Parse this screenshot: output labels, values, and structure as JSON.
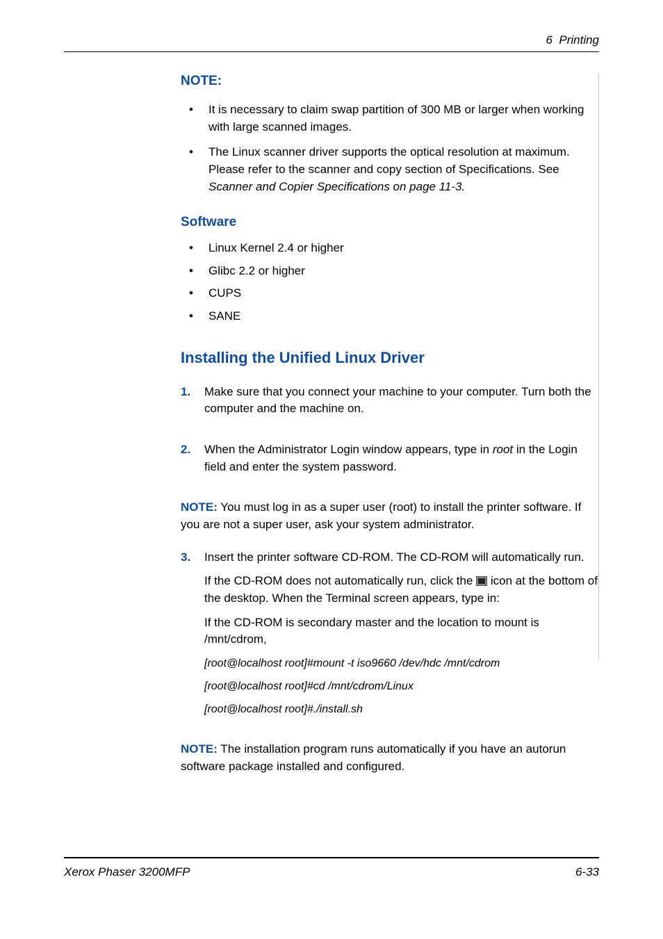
{
  "header": {
    "chapter_num": "6",
    "chapter_title": "Printing"
  },
  "note_heading": "NOTE:",
  "note_bullets": [
    "It is necessary to claim swap partition of 300 MB or larger when working with large scanned images.",
    {
      "text_a": "The Linux scanner driver supports the optical resolution at maximum. Please refer to the scanner and copy section of Specifications. See ",
      "text_b": "Scanner and Copier Specifications on page 11-3."
    }
  ],
  "software": {
    "heading": "Software",
    "items": [
      "Linux Kernel 2.4 or higher",
      "Glibc 2.2 or higher",
      "CUPS",
      "SANE"
    ]
  },
  "install": {
    "heading": "Installing the Unified Linux Driver",
    "step1_num": "1.",
    "step1": "Make sure that you connect your machine to your computer. Turn both the computer and the machine on.",
    "step2_num": "2.",
    "step2_a": "When the Administrator Login window appears, type in ",
    "step2_root": "root",
    "step2_b": " in the Login field and enter the system password.",
    "between_note_label": "NOTE:",
    "between_note": " You must log in as a super user (root) to install the printer software. If you are not a super user, ask your system administrator.",
    "step3_num": "3.",
    "step3_p1": "Insert the printer software CD-ROM. The CD-ROM will automatically run.",
    "step3_p2a": "If the CD-ROM does not automatically run, click the ",
    "step3_p2b": " icon at the bottom of the desktop. When the Terminal screen appears, type in:",
    "step3_p3": "If the CD-ROM is secondary master and the location to mount is /mnt/cdrom,",
    "step3_cmd1": "[root@localhost root]#mount -t iso9660 /dev/hdc /mnt/cdrom",
    "step3_cmd2": "[root@localhost root]#cd /mnt/cdrom/Linux",
    "step3_cmd3": "[root@localhost root]#./install.sh",
    "after_note_label": "NOTE:",
    "after_note": " The installation program runs automatically if you have an autorun software package installed and configured."
  },
  "footer": {
    "left": "Xerox Phaser 3200MFP",
    "right": "6-33"
  }
}
